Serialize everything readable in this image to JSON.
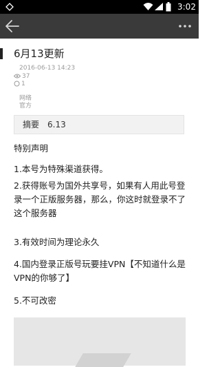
{
  "status_bar": {
    "time": "3:02"
  },
  "article": {
    "title": "6月13更新",
    "date": "2016-06-13 14:23",
    "views": "37",
    "comments": "1",
    "tag_line1": "网络",
    "tag_line2": "官方",
    "summary_label": "摘要",
    "summary_value": "6.13",
    "paragraphs": [
      "特别声明",
      "1.本号为特殊渠道获得。",
      "2.获得账号为国外共享号，如果有人用此号登录一个正版服务器，那么，你这时就登录不了这个服务器",
      "3.有效时间为理论永久",
      "4.国内登录正版号玩要挂VPN【不知道什么是VPN的你够了】",
      "5.不可改密"
    ]
  },
  "icons": {
    "back": "back-arrow-icon",
    "more": "more-vertical-dots-icon",
    "wifi": "wifi-icon",
    "signal": "signal-icon",
    "battery": "battery-icon",
    "views": "eye-icon",
    "comments": "comment-icon"
  }
}
